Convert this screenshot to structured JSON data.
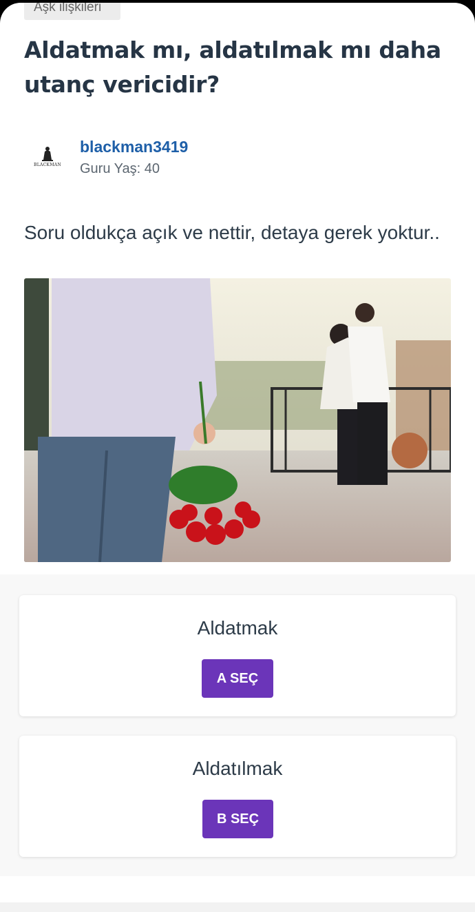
{
  "category": "Aşk ilişkileri",
  "question": {
    "title": "Aldatmak mı, aldatılmak mı daha utanç vericidir?",
    "body": "Soru oldukça açık ve nettir, detaya gerek yoktur.."
  },
  "author": {
    "username": "blackman3419",
    "meta": "Guru Yaş: 40",
    "avatar_text": "BLACKMAN"
  },
  "options": [
    {
      "label": "Aldatmak",
      "button": "A SEÇ"
    },
    {
      "label": "Aldatılmak",
      "button": "B SEÇ"
    }
  ],
  "colors": {
    "title": "#263545",
    "username": "#1e5fa8",
    "button": "#6b35b9"
  }
}
